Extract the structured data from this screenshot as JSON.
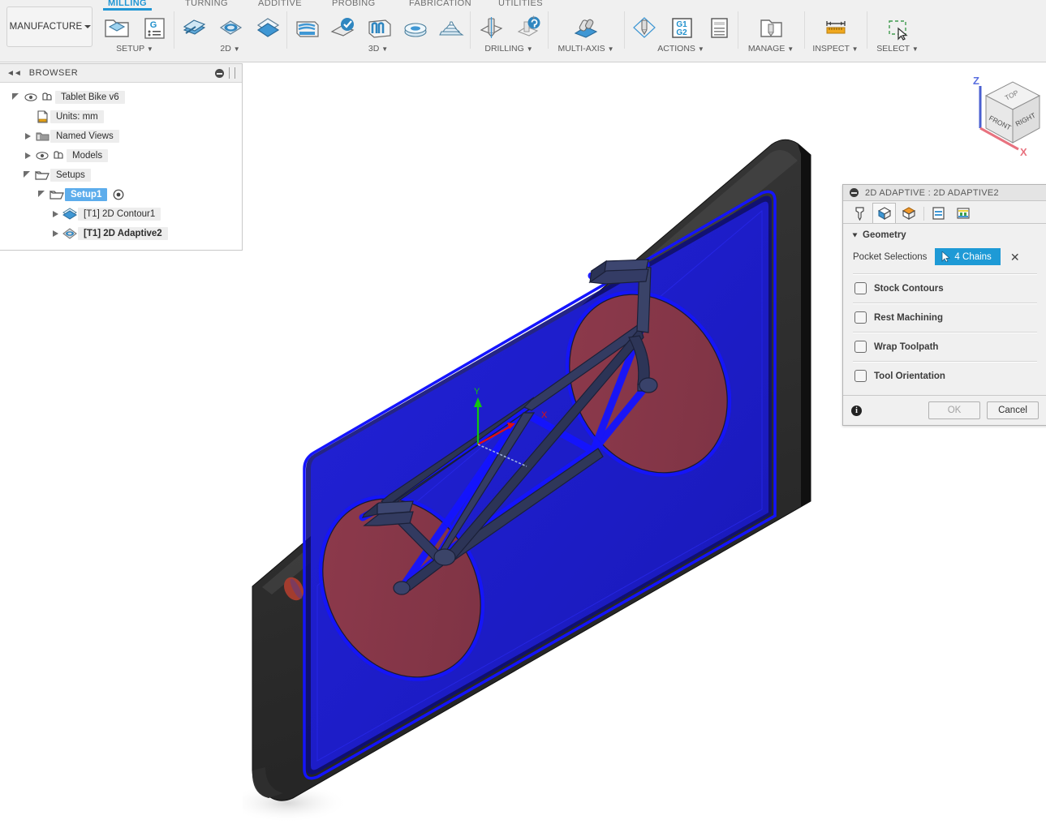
{
  "ribbon": {
    "workspace_button": "MANUFACTURE",
    "tabs": [
      {
        "label": "MILLING",
        "active": true
      },
      {
        "label": "TURNING",
        "active": false
      },
      {
        "label": "ADDITIVE",
        "active": false
      },
      {
        "label": "PROBING",
        "active": false
      },
      {
        "label": "FABRICATION",
        "active": false
      },
      {
        "label": "UTILITIES",
        "active": false
      }
    ],
    "panels": [
      {
        "label": "SETUP",
        "icons": [
          "setup-folder-icon",
          "generate-nc-program-icon"
        ]
      },
      {
        "label": "2D",
        "icons": [
          "face-icon",
          "adaptive-2d-icon",
          "contour-2d-icon"
        ]
      },
      {
        "label": "3D",
        "icons": [
          "adaptive-3d-icon",
          "pocket-clearing-icon",
          "parallel-icon",
          "scallop-icon",
          "spiral-icon"
        ]
      },
      {
        "label": "DRILLING",
        "icons": [
          "drill-icon",
          "bore-icon"
        ]
      },
      {
        "label": "MULTI-AXIS",
        "icons": [
          "swarf-icon"
        ]
      },
      {
        "label": "ACTIONS",
        "icons": [
          "simulate-icon",
          "post-process-icon",
          "setup-sheet-icon"
        ]
      },
      {
        "label": "MANAGE",
        "icons": [
          "tool-library-icon"
        ]
      },
      {
        "label": "INSPECT",
        "icons": [
          "measure-icon"
        ]
      },
      {
        "label": "SELECT",
        "icons": [
          "select-window-icon"
        ]
      }
    ]
  },
  "browser": {
    "title": "BROWSER",
    "collapse_icon": "collapse-arrows-icon",
    "minimize_icon": "minimize-icon",
    "tree": [
      {
        "label": "Tablet Bike v6",
        "indent": 0,
        "expander": "open",
        "eye": true,
        "icon": "component-icon",
        "selected": false,
        "bold": false
      },
      {
        "label": "Units: mm",
        "indent": 1,
        "expander": "none",
        "eye": false,
        "icon": "units-icon",
        "selected": false,
        "bold": false
      },
      {
        "label": "Named Views",
        "indent": 1,
        "expander": "closed",
        "eye": false,
        "icon": "folder-views-icon",
        "selected": false,
        "bold": false
      },
      {
        "label": "Models",
        "indent": 1,
        "expander": "closed",
        "eye": true,
        "icon": "component-icon",
        "selected": false,
        "bold": false
      },
      {
        "label": "Setups",
        "indent": 1,
        "expander": "open",
        "eye": false,
        "icon": "setup-folder-icon",
        "selected": false,
        "bold": false
      },
      {
        "label": "Setup1",
        "indent": 2,
        "expander": "open",
        "eye": false,
        "icon": "setup-folder-icon",
        "selected": true,
        "bold": true,
        "badge": "target-icon"
      },
      {
        "label": "[T1] 2D Contour1",
        "indent": 3,
        "expander": "closed",
        "eye": false,
        "icon": "contour-2d-icon",
        "selected": false,
        "bold": false
      },
      {
        "label": "[T1] 2D Adaptive2",
        "indent": 3,
        "expander": "closed",
        "eye": false,
        "icon": "adaptive-2d-icon",
        "selected": false,
        "bold": true
      }
    ]
  },
  "viewcube": {
    "top_face": "TOP",
    "front_face": "FRONT",
    "right_face": "RIGHT",
    "axis_z": "Z",
    "axis_x": "X",
    "color_z": "#4a5fd0",
    "color_x": "#e8727f"
  },
  "canvas": {
    "origin_marker": {
      "axis_y": "Y",
      "axis_x": "X",
      "color_y": "#12c412",
      "color_x": "#e01010"
    },
    "colors": {
      "bezel_dark": "#2b2b2b",
      "bezel_edge": "#1b1b1b",
      "pocket_blue": "#1f1fcf",
      "highlight_blue": "#1414ff",
      "wheel_red": "#8e3c4e",
      "frame_navy": "#2d3559",
      "background": "#ffffff"
    }
  },
  "dialog": {
    "minimize_icon": "minimize-icon",
    "title": "2D ADAPTIVE : 2D ADAPTIVE2",
    "tabs": [
      {
        "name": "tool-tab",
        "icon": "tool-icon",
        "active": false
      },
      {
        "name": "geometry-tab",
        "icon": "geometry-cube-icon",
        "active": true
      },
      {
        "name": "heights-tab",
        "icon": "heights-cube-icon",
        "active": false
      },
      {
        "name": "passes-tab",
        "icon": "passes-icon",
        "active": false
      },
      {
        "name": "linking-tab",
        "icon": "linking-icon",
        "active": false
      }
    ],
    "geometry": {
      "group_label": "Geometry",
      "pocket_selections_label": "Pocket Selections",
      "selection_value": "4 Chains",
      "selection_icon": "cursor-arrow-icon",
      "clear_icon": "close-x-icon",
      "accent_color": "#1e9ad6"
    },
    "options": [
      {
        "label": "Stock Contours",
        "checked": false
      },
      {
        "label": "Rest Machining",
        "checked": false
      },
      {
        "label": "Wrap Toolpath",
        "checked": false
      },
      {
        "label": "Tool Orientation",
        "checked": false
      }
    ],
    "footer": {
      "info_icon": "info-icon",
      "ok_label": "OK",
      "ok_enabled": false,
      "cancel_label": "Cancel",
      "cancel_enabled": true
    }
  }
}
